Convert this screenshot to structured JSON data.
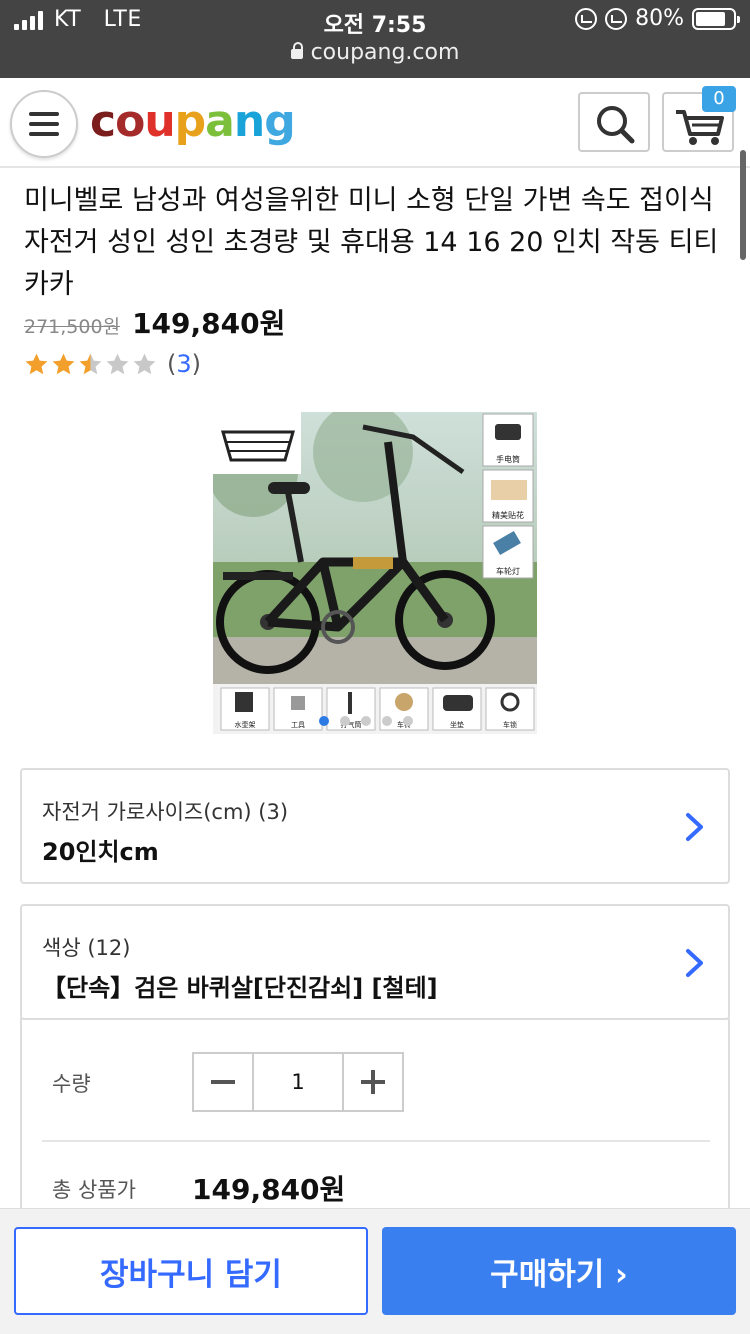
{
  "status_bar": {
    "carrier": "KT",
    "network": "LTE",
    "time": "오전 7:55",
    "battery_percent": "80%",
    "battery_level": 0.8
  },
  "browser": {
    "url": "coupang.com"
  },
  "header": {
    "logo": {
      "letters": [
        "c",
        "o",
        "u",
        "p",
        "a",
        "n",
        "g"
      ],
      "colors": [
        "#7b1d1d",
        "#a52a2a",
        "#e0302a",
        "#e8a11a",
        "#7bbf3a",
        "#1aa3d9",
        "#3fa8e0"
      ]
    },
    "cart_count": "0"
  },
  "product": {
    "title": "미니벨로 남성과 여성을위한 미니 소형 단일 가변 속도 접이식 자전거 성인 성인 초경량 및 휴대용 14 16 20 인치 작동 티티카카",
    "original_price": "271,500원",
    "price": "149,840원",
    "rating": 2.5,
    "rating_count": "3",
    "image": {
      "side_labels": [
        "手电筒",
        "精美贴花",
        "车轮灯"
      ],
      "bottom_labels": [
        "水壶架",
        "工具",
        "打气筒",
        "车铃",
        "坐垫",
        "车锁"
      ],
      "image_count": 5,
      "active_index": 0
    }
  },
  "options": [
    {
      "label": "자전거 가로사이즈(cm) (3)",
      "value": "20인치cm"
    },
    {
      "label": "색상 (12)",
      "value": "【단속】검은 바퀴살[단진감쇠] [철테]"
    }
  ],
  "quantity": {
    "label": "수량",
    "value": "1"
  },
  "total": {
    "label": "총 상품가",
    "value": "149,840원"
  },
  "actions": {
    "add_to_cart": "장바구니 담기",
    "buy_now": "구매하기 ›"
  },
  "colors": {
    "accent": "#346aff",
    "buy_button": "#3a7ff0",
    "star": "#f2a02b"
  }
}
